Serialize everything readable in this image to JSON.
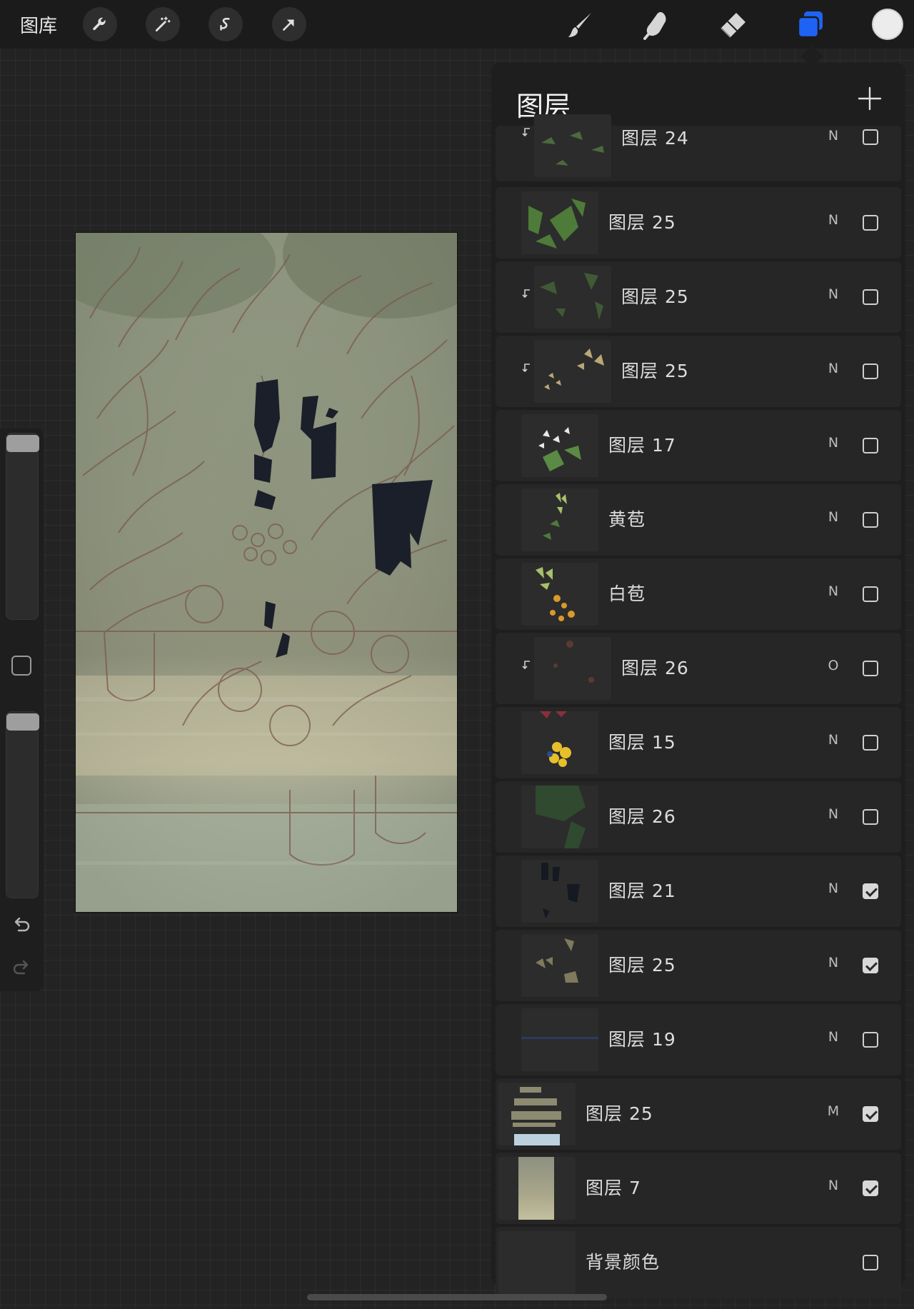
{
  "topbar": {
    "gallery_label": "图库",
    "left_tools": [
      "wrench-icon",
      "magic-wand-icon",
      "selection-icon",
      "transform-arrow-icon"
    ],
    "right_tools": [
      "brush-icon",
      "smudge-icon",
      "eraser-icon",
      "layers-icon"
    ],
    "active_tool": "layers-icon",
    "current_color": "#ececec",
    "accent_color": "#1f63f5"
  },
  "sidebar": {
    "brush_size_level": 0.0,
    "opacity_level": 0.0,
    "icons": [
      "modify-button-icon",
      "undo-icon",
      "redo-icon"
    ]
  },
  "layers_panel": {
    "title": "图层",
    "add_icon": "plus-icon",
    "layers": [
      {
        "name": "图层 24",
        "blend": "N",
        "visible": false,
        "clipped": true
      },
      {
        "name": "图层 25",
        "blend": "N",
        "visible": false,
        "clipped": false
      },
      {
        "name": "图层 25",
        "blend": "N",
        "visible": false,
        "clipped": true
      },
      {
        "name": "图层 25",
        "blend": "N",
        "visible": false,
        "clipped": true
      },
      {
        "name": "图层 17",
        "blend": "N",
        "visible": false,
        "clipped": false
      },
      {
        "name": "黄苞",
        "blend": "N",
        "visible": false,
        "clipped": false
      },
      {
        "name": "白苞",
        "blend": "N",
        "visible": false,
        "clipped": false
      },
      {
        "name": "图层 26",
        "blend": "O",
        "visible": false,
        "clipped": true
      },
      {
        "name": "图层 15",
        "blend": "N",
        "visible": false,
        "clipped": false
      },
      {
        "name": "图层 26",
        "blend": "N",
        "visible": false,
        "clipped": false
      },
      {
        "name": "图层 21",
        "blend": "N",
        "visible": true,
        "clipped": false
      },
      {
        "name": "图层 25",
        "blend": "N",
        "visible": true,
        "clipped": false
      },
      {
        "name": "图层 19",
        "blend": "N",
        "visible": false,
        "clipped": false
      },
      {
        "name": "图层 25",
        "blend": "M",
        "visible": true,
        "clipped": false
      },
      {
        "name": "图层 7",
        "blend": "N",
        "visible": true,
        "clipped": false
      },
      {
        "name": "背景颜色",
        "blend": "",
        "visible": false,
        "clipped": false
      }
    ]
  }
}
